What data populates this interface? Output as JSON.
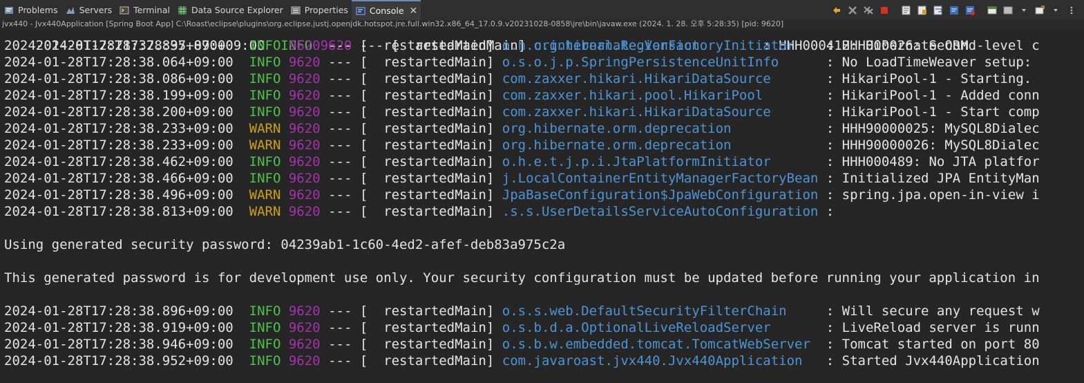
{
  "tabs": [
    {
      "label": "Problems",
      "icon": "problems-icon"
    },
    {
      "label": "Servers",
      "icon": "servers-icon"
    },
    {
      "label": "Terminal",
      "icon": "terminal-icon"
    },
    {
      "label": "Data Source Explorer",
      "icon": "data-source-icon"
    },
    {
      "label": "Properties",
      "icon": "properties-icon"
    },
    {
      "label": "Console",
      "icon": "console-icon",
      "active": true
    }
  ],
  "process_title": "jvx440 - Jvx440Application [Spring Boot App] C:\\Roast\\eclipse\\plugins\\org.eclipse.justj.openjdk.hotspot.jre.full.win32.x86_64_17.0.9.v20231028-0858\\jre\\bin\\javaw.exe  (2024. 1. 28. 오후 5:28:35) [pid: 9620]",
  "console": {
    "partial_top": {
      "ts": "2024-01-28T17:28:37.870+09:00",
      "level": "INFO",
      "pid": "9620",
      "sep": "---",
      "thread": "restartedMain",
      "logger": "org.hibernate.Version",
      "msg": "HHH000412: Hibernate ORM"
    },
    "lines": [
      {
        "ts": "2024-01-28T17:28:37.895+09:00",
        "level": "INFO",
        "pid": "9620",
        "sep": "---",
        "thread": "restartedMain",
        "logger": "o.h.c.internal.RegionFactoryInitiator",
        "msg": "HHH000026: Second-level c"
      },
      {
        "ts": "2024-01-28T17:28:38.064+09:00",
        "level": "INFO",
        "pid": "9620",
        "sep": "---",
        "thread": "restartedMain",
        "logger": "o.s.o.j.p.SpringPersistenceUnitInfo",
        "msg": "No LoadTimeWeaver setup:"
      },
      {
        "ts": "2024-01-28T17:28:38.086+09:00",
        "level": "INFO",
        "pid": "9620",
        "sep": "---",
        "thread": "restartedMain",
        "logger": "com.zaxxer.hikari.HikariDataSource",
        "msg": "HikariPool-1 - Starting."
      },
      {
        "ts": "2024-01-28T17:28:38.199+09:00",
        "level": "INFO",
        "pid": "9620",
        "sep": "---",
        "thread": "restartedMain",
        "logger": "com.zaxxer.hikari.pool.HikariPool",
        "msg": "HikariPool-1 - Added conn"
      },
      {
        "ts": "2024-01-28T17:28:38.200+09:00",
        "level": "INFO",
        "pid": "9620",
        "sep": "---",
        "thread": "restartedMain",
        "logger": "com.zaxxer.hikari.HikariDataSource",
        "msg": "HikariPool-1 - Start comp"
      },
      {
        "ts": "2024-01-28T17:28:38.233+09:00",
        "level": "WARN",
        "pid": "9620",
        "sep": "---",
        "thread": "restartedMain",
        "logger": "org.hibernate.orm.deprecation",
        "msg": "HHH90000025: MySQL8Dialec"
      },
      {
        "ts": "2024-01-28T17:28:38.233+09:00",
        "level": "WARN",
        "pid": "9620",
        "sep": "---",
        "thread": "restartedMain",
        "logger": "org.hibernate.orm.deprecation",
        "msg": "HHH90000026: MySQL8Dialec"
      },
      {
        "ts": "2024-01-28T17:28:38.462+09:00",
        "level": "INFO",
        "pid": "9620",
        "sep": "---",
        "thread": "restartedMain",
        "logger": "o.h.e.t.j.p.i.JtaPlatformInitiator",
        "msg": "HHH000489: No JTA platfor"
      },
      {
        "ts": "2024-01-28T17:28:38.466+09:00",
        "level": "INFO",
        "pid": "9620",
        "sep": "---",
        "thread": "restartedMain",
        "logger": "j.LocalContainerEntityManagerFactoryBean",
        "msg": "Initialized JPA EntityMan"
      },
      {
        "ts": "2024-01-28T17:28:38.496+09:00",
        "level": "WARN",
        "pid": "9620",
        "sep": "---",
        "thread": "restartedMain",
        "logger": "JpaBaseConfiguration$JpaWebConfiguration",
        "msg": "spring.jpa.open-in-view i"
      },
      {
        "ts": "2024-01-28T17:28:38.813+09:00",
        "level": "WARN",
        "pid": "9620",
        "sep": "---",
        "thread": "restartedMain",
        "logger": ".s.s.UserDetailsServiceAutoConfiguration",
        "msg": ""
      }
    ],
    "password_line": "Using generated security password: 04239ab1-1c60-4ed2-afef-deb83a975c2a",
    "notice_line": "This generated password is for development use only. Your security configuration must be updated before running your application in",
    "lines2": [
      {
        "ts": "2024-01-28T17:28:38.896+09:00",
        "level": "INFO",
        "pid": "9620",
        "sep": "---",
        "thread": "restartedMain",
        "logger": "o.s.s.web.DefaultSecurityFilterChain",
        "msg": "Will secure any request w"
      },
      {
        "ts": "2024-01-28T17:28:38.919+09:00",
        "level": "INFO",
        "pid": "9620",
        "sep": "---",
        "thread": "restartedMain",
        "logger": "o.s.b.d.a.OptionalLiveReloadServer",
        "msg": "LiveReload server is runn"
      },
      {
        "ts": "2024-01-28T17:28:38.946+09:00",
        "level": "INFO",
        "pid": "9620",
        "sep": "---",
        "thread": "restartedMain",
        "logger": "o.s.b.w.embedded.tomcat.TomcatWebServer",
        "msg": "Tomcat started on port 80"
      },
      {
        "ts": "2024-01-28T17:28:38.952+09:00",
        "level": "INFO",
        "pid": "9620",
        "sep": "---",
        "thread": "restartedMain",
        "logger": "com.javaroast.jvx440.Jvx440Application",
        "msg": "Started Jvx440Application"
      }
    ]
  },
  "colors": {
    "info": "#4fc24a",
    "warn": "#c9a21a",
    "pid": "#a630b0",
    "logger": "#4d95d6"
  }
}
